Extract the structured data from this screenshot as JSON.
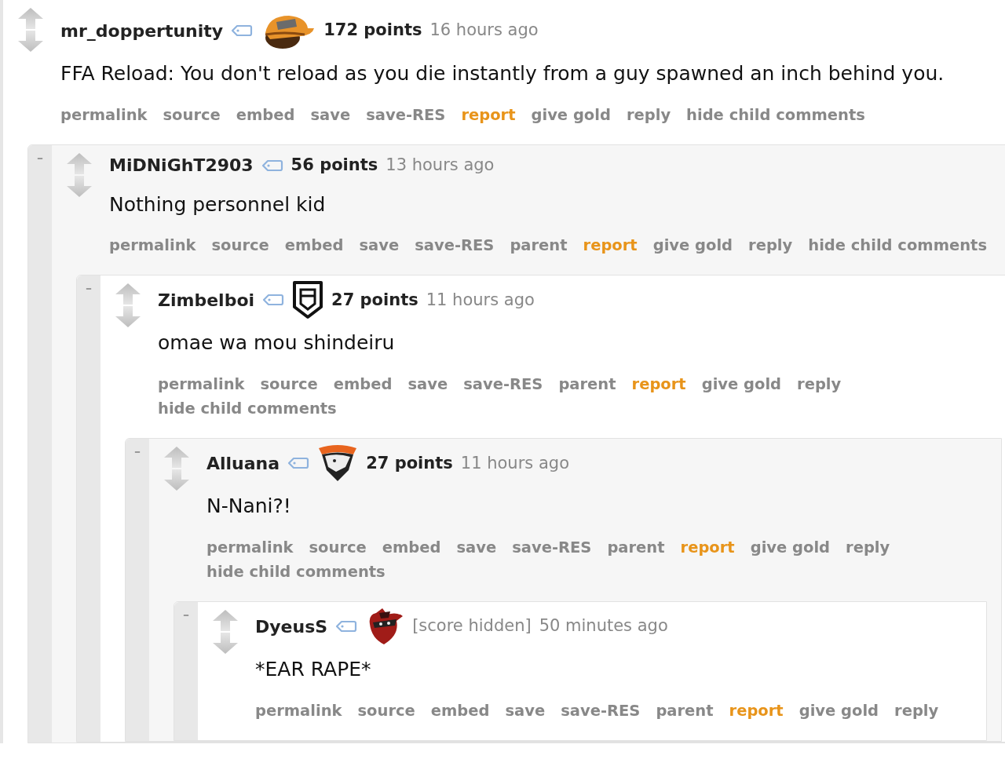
{
  "comments": [
    {
      "author": "mr_doppertunity",
      "flair": {
        "kind": "cap"
      },
      "score": "172 points",
      "score_hidden": false,
      "time": "16 hours ago",
      "body": "FFA Reload: You don't reload as you die instantly from a guy spawned an inch behind you.",
      "actions": [
        {
          "label": "permalink",
          "kind": "normal"
        },
        {
          "label": "source",
          "kind": "normal"
        },
        {
          "label": "embed",
          "kind": "normal"
        },
        {
          "label": "save",
          "kind": "normal"
        },
        {
          "label": "save-RES",
          "kind": "normal"
        },
        {
          "label": "report",
          "kind": "warning"
        },
        {
          "label": "give gold",
          "kind": "normal"
        },
        {
          "label": "reply",
          "kind": "normal"
        },
        {
          "label": "hide child comments",
          "kind": "normal"
        }
      ],
      "children": [
        {
          "collapse": "–",
          "author": "MiDNiGhT2903",
          "score": "56 points",
          "score_hidden": false,
          "time": "13 hours ago",
          "body": "Nothing personnel kid",
          "actions": [
            {
              "label": "permalink",
              "kind": "normal"
            },
            {
              "label": "source",
              "kind": "normal"
            },
            {
              "label": "embed",
              "kind": "normal"
            },
            {
              "label": "save",
              "kind": "normal"
            },
            {
              "label": "save-RES",
              "kind": "normal"
            },
            {
              "label": "parent",
              "kind": "normal"
            },
            {
              "label": "report",
              "kind": "warning"
            },
            {
              "label": "give gold",
              "kind": "normal"
            },
            {
              "label": "reply",
              "kind": "normal"
            },
            {
              "label": "hide child comments",
              "kind": "normal"
            }
          ],
          "children": [
            {
              "collapse": "–",
              "author": "Zimbelboi",
              "flair": {
                "kind": "shield"
              },
              "score": "27 points",
              "score_hidden": false,
              "time": "11 hours ago",
              "body": "omae wa mou shindeiru",
              "actions": [
                {
                  "label": "permalink",
                  "kind": "normal"
                },
                {
                  "label": "source",
                  "kind": "normal"
                },
                {
                  "label": "embed",
                  "kind": "normal"
                },
                {
                  "label": "save",
                  "kind": "normal"
                },
                {
                  "label": "save-RES",
                  "kind": "normal"
                },
                {
                  "label": "parent",
                  "kind": "normal"
                },
                {
                  "label": "report",
                  "kind": "warning"
                },
                {
                  "label": "give gold",
                  "kind": "normal"
                },
                {
                  "label": "reply",
                  "kind": "normal"
                },
                {
                  "label": "hide child comments",
                  "kind": "normal"
                }
              ],
              "children": [
                {
                  "collapse": "–",
                  "author": "Alluana",
                  "flair": {
                    "kind": "emblem"
                  },
                  "score": "27 points",
                  "score_hidden": false,
                  "time": "11 hours ago",
                  "body": "N-Nani?!",
                  "actions": [
                    {
                      "label": "permalink",
                      "kind": "normal"
                    },
                    {
                      "label": "source",
                      "kind": "normal"
                    },
                    {
                      "label": "embed",
                      "kind": "normal"
                    },
                    {
                      "label": "save",
                      "kind": "normal"
                    },
                    {
                      "label": "save-RES",
                      "kind": "normal"
                    },
                    {
                      "label": "parent",
                      "kind": "normal"
                    },
                    {
                      "label": "report",
                      "kind": "warning"
                    },
                    {
                      "label": "give gold",
                      "kind": "normal"
                    },
                    {
                      "label": "reply",
                      "kind": "normal"
                    },
                    {
                      "label": "hide child comments",
                      "kind": "normal"
                    }
                  ],
                  "children": [
                    {
                      "collapse": "–",
                      "author": "DyeusS",
                      "flair": {
                        "kind": "hat"
                      },
                      "score": "[score hidden]",
                      "score_hidden": true,
                      "time": "50 minutes ago",
                      "body": "*EAR RAPE*",
                      "actions": [
                        {
                          "label": "permalink",
                          "kind": "normal"
                        },
                        {
                          "label": "source",
                          "kind": "normal"
                        },
                        {
                          "label": "embed",
                          "kind": "normal"
                        },
                        {
                          "label": "save",
                          "kind": "normal"
                        },
                        {
                          "label": "save-RES",
                          "kind": "normal"
                        },
                        {
                          "label": "parent",
                          "kind": "normal"
                        },
                        {
                          "label": "report",
                          "kind": "warning"
                        },
                        {
                          "label": "give gold",
                          "kind": "normal"
                        },
                        {
                          "label": "reply",
                          "kind": "normal"
                        }
                      ]
                    }
                  ]
                }
              ]
            }
          ]
        }
      ]
    }
  ]
}
